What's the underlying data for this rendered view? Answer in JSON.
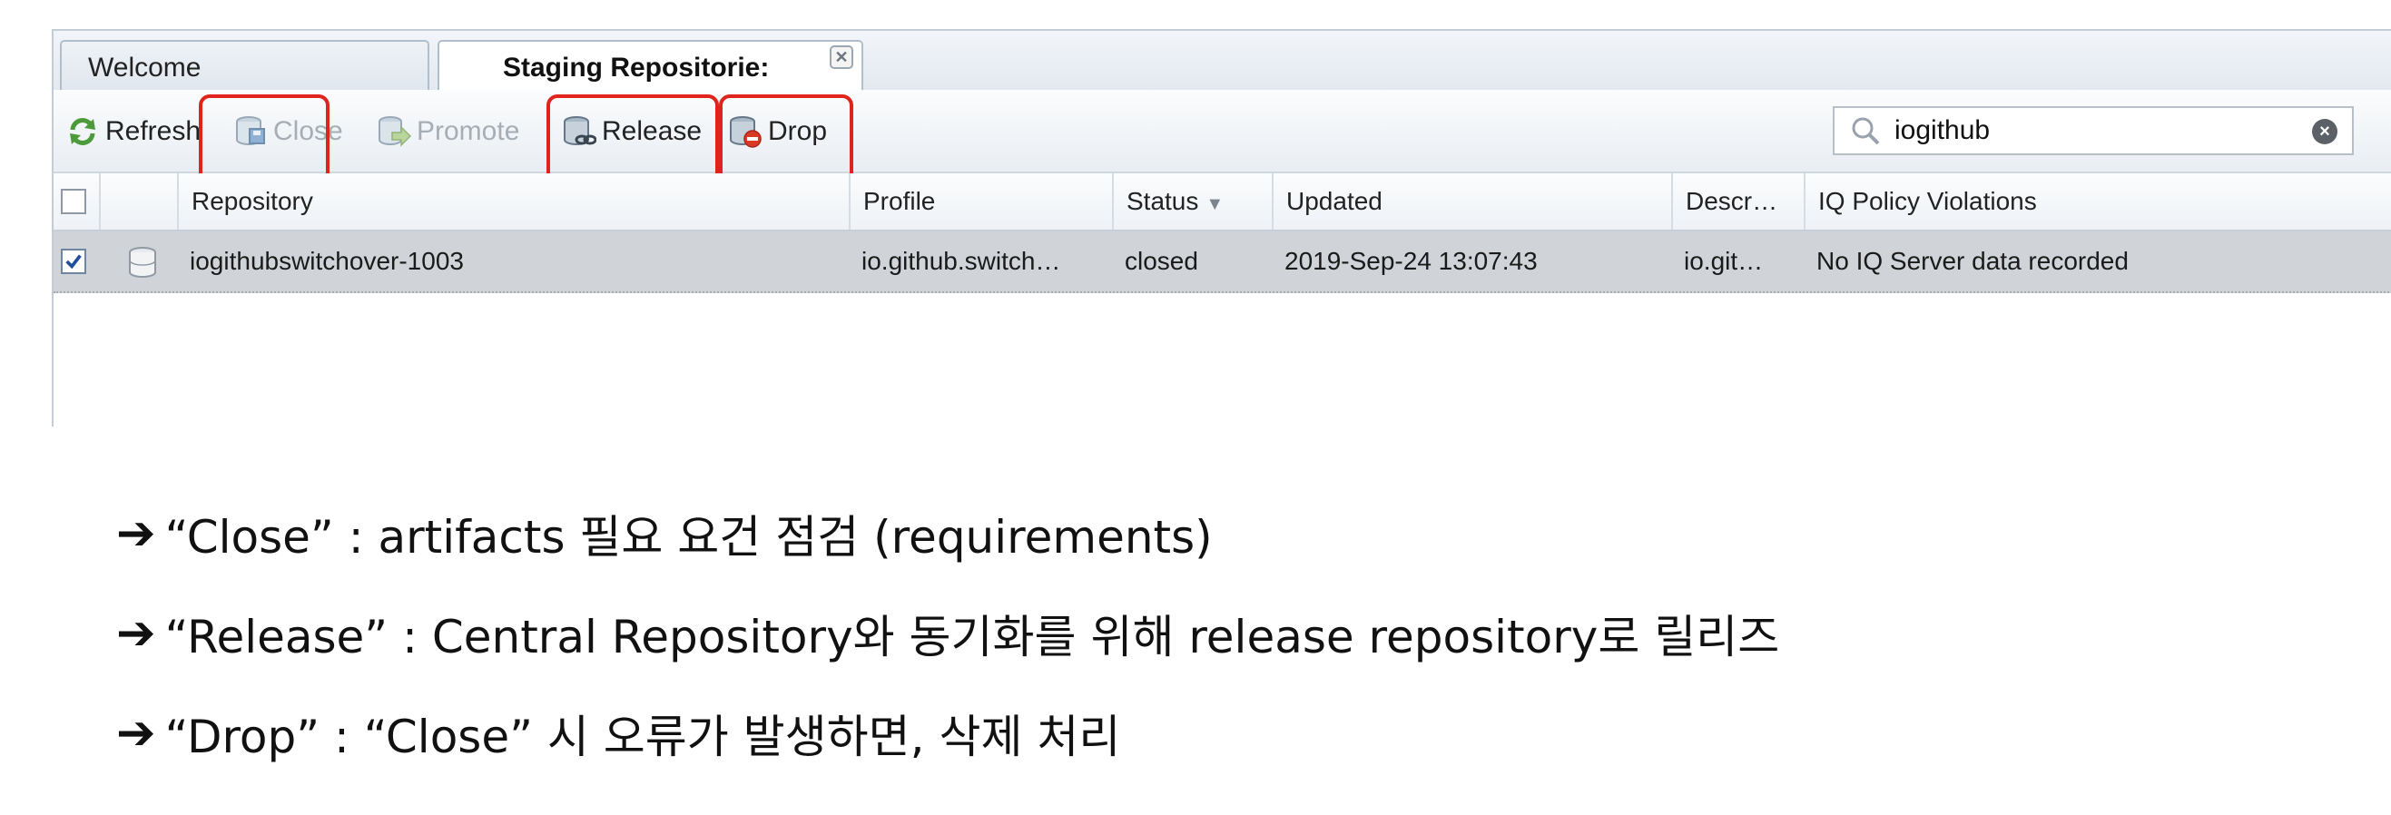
{
  "tabs": [
    {
      "label": "Welcome",
      "active": false
    },
    {
      "label": "Staging Repositorie:",
      "active": true,
      "close_icon": "close-icon"
    }
  ],
  "toolbar": {
    "buttons": [
      {
        "label": "Refresh",
        "icon": "refresh-icon",
        "enabled": true,
        "highlighted": false
      },
      {
        "label": "Close",
        "icon": "close-repository-icon",
        "enabled": false,
        "highlighted": true
      },
      {
        "label": "Promote",
        "icon": "promote-icon",
        "enabled": false,
        "highlighted": false
      },
      {
        "label": "Release",
        "icon": "release-icon",
        "enabled": true,
        "highlighted": true
      },
      {
        "label": "Drop",
        "icon": "drop-icon",
        "enabled": true,
        "highlighted": true
      }
    ],
    "search": {
      "value": "iogithub",
      "icon": "search-icon",
      "clear_icon": "clear-icon"
    }
  },
  "grid": {
    "columns": [
      "Repository",
      "Profile",
      "Status",
      "Updated",
      "Descr…",
      "IQ Policy Violations"
    ],
    "sorted_column": "Status",
    "rows": [
      {
        "checked": true,
        "icon": "repository-icon",
        "repository": "iogithubswitchover-1003",
        "profile": "io.github.switch…",
        "status": "closed",
        "updated": "2019-Sep-24 13:07:43",
        "description": "io.git…",
        "iq_policy": "No IQ Server data recorded"
      }
    ]
  },
  "notes": [
    {
      "arrow": "➔",
      "text": "“Close” : artifacts 필요 요건 점검 (requirements)"
    },
    {
      "arrow": "➔",
      "text": "“Release” : Central Repository와 동기화를 위해 release repository로 릴리즈"
    },
    {
      "arrow": "➔",
      "text": "“Drop” : “Close” 시 오류가 발생하면, 삭제 처리"
    }
  ],
  "colors": {
    "highlight": "#e0241d",
    "selected_row": "#d0d4d8",
    "header_gradient_top": "#fbfcfd",
    "border": "#c3cdd8"
  }
}
